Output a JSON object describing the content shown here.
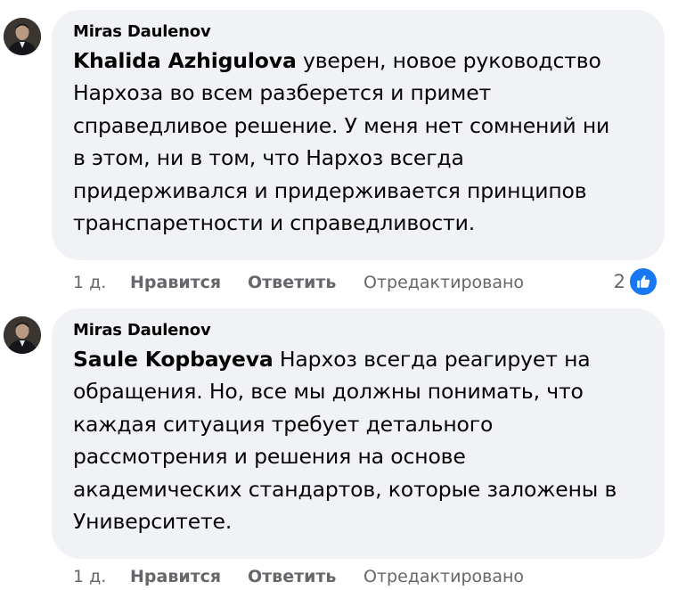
{
  "comments": [
    {
      "author": "Miras Daulenov",
      "mention": "Khalida Azhigulova",
      "lines": [
        " уверен, новое руководство",
        "Нархоза во всем разберется и примет",
        "справедливое решение. У меня нет сомнений ни",
        "в этом, ни в том, что Нархоз всегда",
        "придерживался и придерживается принципов",
        "транспаретности и справедливости."
      ],
      "time": "1 д.",
      "like_label": "Нравится",
      "reply_label": "Ответить",
      "edited_label": "Отредактировано",
      "reaction_count": "2",
      "reaction_icon": "like-icon",
      "reaction_color": "#1877f2"
    },
    {
      "author": "Miras Daulenov",
      "mention": "Saule Kopbayeva",
      "lines": [
        " Нархоз всегда реагирует на",
        "обращения. Но, все мы должны понимать, что",
        "каждая ситуация требует детального",
        "рассмотрения и решения на основе",
        "академических стандартов, которые заложены в",
        "Университете."
      ],
      "time": "1 д.",
      "like_label": "Нравится",
      "reply_label": "Ответить",
      "edited_label": "Отредактировано"
    }
  ]
}
